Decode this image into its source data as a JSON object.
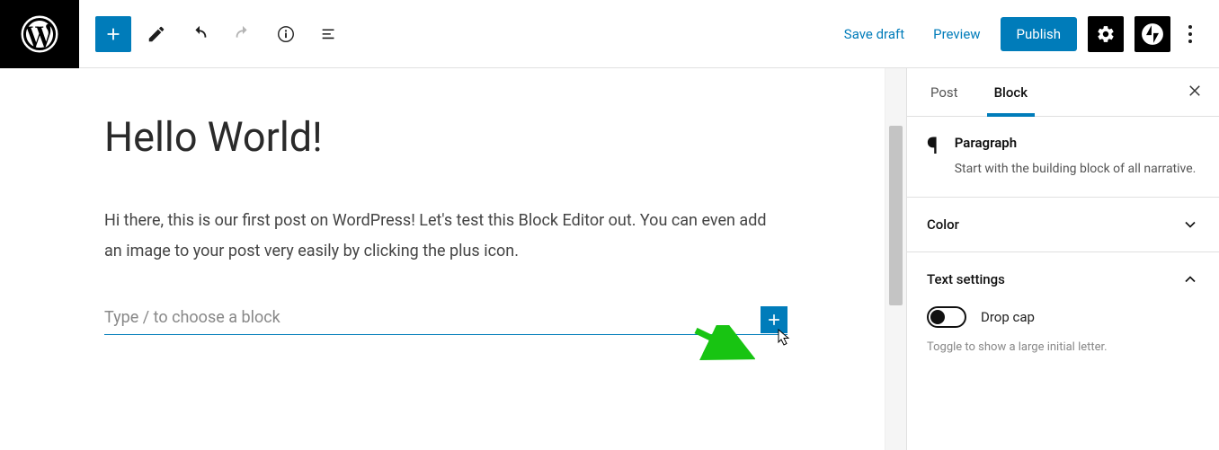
{
  "toolbar": {
    "save_draft": "Save draft",
    "preview": "Preview",
    "publish": "Publish"
  },
  "editor": {
    "title": "Hello World!",
    "body": "Hi there, this is our first post on WordPress! Let's test this Block Editor out. You can even add an image to your post very easily by clicking the plus icon.",
    "placeholder": "Type / to choose a block"
  },
  "sidebar": {
    "tabs": {
      "post": "Post",
      "block": "Block"
    },
    "block_type": {
      "name": "Paragraph",
      "description": "Start with the building block of all narrative."
    },
    "panels": {
      "color": "Color",
      "text_settings": "Text settings"
    },
    "dropcap_label": "Drop cap",
    "dropcap_hint": "Toggle to show a large initial letter."
  }
}
